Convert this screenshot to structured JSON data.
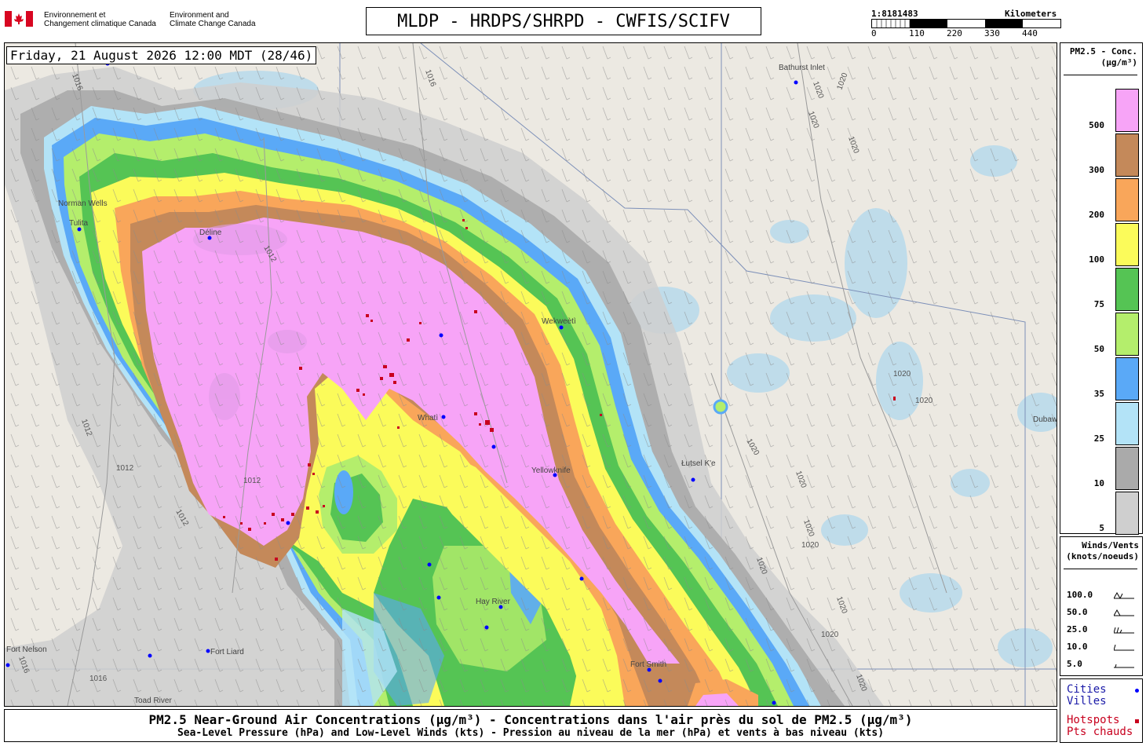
{
  "header": {
    "org_fr_line1": "Environnement et",
    "org_fr_line2": "Changement climatique Canada",
    "org_en_line1": "Environment and",
    "org_en_line2": "Climate Change Canada",
    "title": "MLDP - HRDPS/SHRPD - CWFIS/SCIFV",
    "scale_ratio": "1:8181483",
    "scale_unit": "Kilometers",
    "scale_ticks": [
      "0",
      "110",
      "220",
      "330",
      "440"
    ]
  },
  "map": {
    "datetime": "Friday, 21 August 2026 12:00 MDT (28/46)",
    "places": [
      "Bathurst Inlet",
      "Norman Wells",
      "Tulita",
      "Déline",
      "Wekweètì",
      "Whatì",
      "Yellowknife",
      "Łutsel K'e",
      "Hay River",
      "Fort Liard",
      "Fort Smith",
      "Toad River",
      "Dubawnt Lake",
      "Fort Nelson"
    ],
    "isobars": [
      "1016",
      "1012",
      "1020"
    ],
    "colors": {
      "land": "#ece9e2",
      "water": "#bfdcea",
      "city": "#0000ff",
      "hotspot": "#c8001e"
    }
  },
  "legend": {
    "conc_title_1": "PM2.5 - Conc.",
    "conc_title_2": "(µg/m³)",
    "classes": [
      {
        "value": "500",
        "color": "#f7a4f7"
      },
      {
        "value": "300",
        "color": "#c4895a"
      },
      {
        "value": "200",
        "color": "#f9a65a"
      },
      {
        "value": "100",
        "color": "#fbfb5a"
      },
      {
        "value": "75",
        "color": "#55c454"
      },
      {
        "value": "50",
        "color": "#b4ee6c"
      },
      {
        "value": "35",
        "color": "#5aa9f7"
      },
      {
        "value": "25",
        "color": "#b3e3f7"
      },
      {
        "value": "10",
        "color": "#aaaaaa"
      },
      {
        "value": "5",
        "color": "#cfcfcf"
      }
    ],
    "winds_title_1": "Winds/Vents",
    "winds_title_2": "(knots/noeuds)",
    "winds": [
      "100.0",
      "50.0",
      "25.0",
      "10.0",
      "5.0"
    ],
    "cities_1": "Cities",
    "cities_2": "Villes",
    "hotspots_1": "Hotspots",
    "hotspots_2": "Pts chauds"
  },
  "caption": {
    "line1": "PM2.5 Near-Ground Air Concentrations (µg/m³) - Concentrations dans l'air près du sol de PM2.5 (µg/m³)",
    "line2": "Sea-Level Pressure (hPa) and Low-Level Winds (kts) - Pression au niveau de la mer (hPa) et vents à bas niveau (kts)"
  }
}
